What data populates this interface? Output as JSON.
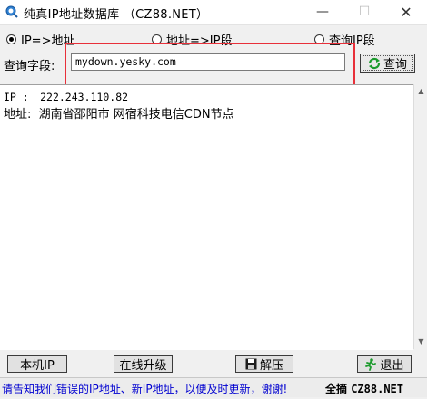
{
  "window": {
    "title": "纯真IP地址数据库 （CZ88.NET）",
    "controls": {
      "minimize": "—",
      "maximize": "☐",
      "close": "✕"
    }
  },
  "modes": [
    {
      "label": "IP=>地址",
      "selected": true
    },
    {
      "label": "地址=>IP段",
      "selected": false
    },
    {
      "label": "查询IP段",
      "selected": false
    }
  ],
  "query": {
    "label": "查询字段:",
    "value": "mydown.yesky.com",
    "button": "查询"
  },
  "result": {
    "ip_label": "IP :",
    "ip_value": "222.243.110.82",
    "addr_label": "地址:",
    "addr_value": "湖南省邵阳市 网宿科技电信CDN节点"
  },
  "buttons": {
    "local_ip": "本机IP",
    "online_upgrade": "在线升级",
    "unzip": "解压",
    "exit": "退出"
  },
  "status": {
    "message": "请告知我们错误的IP地址、新IP地址，以便及时更新，谢谢!",
    "brand": "全摘",
    "site": "CZ88.NET"
  },
  "colors": {
    "highlight": "#e8303a",
    "link": "#0000d0"
  },
  "icons": {
    "app": "search-globe-icon",
    "query": "refresh-icon",
    "unzip": "floppy-disk-icon",
    "exit": "running-man-icon"
  }
}
